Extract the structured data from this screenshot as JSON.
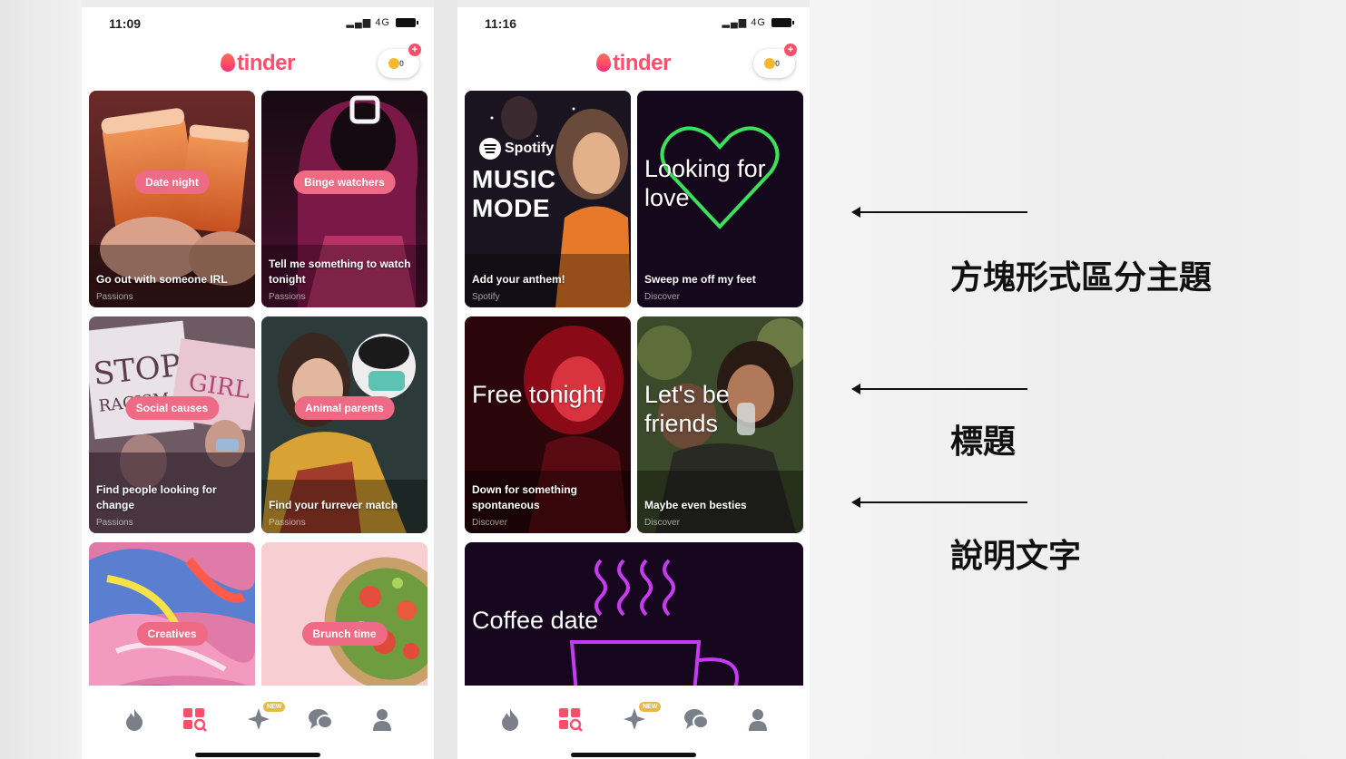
{
  "phones": [
    {
      "time": "11:09",
      "network": "4G",
      "logo": "tinder",
      "boost_count": "0",
      "cards": [
        {
          "pill": "Date night",
          "desc": "Go out with someone IRL",
          "cat": "Passions"
        },
        {
          "pill": "Binge watchers",
          "desc": "Tell me something to watch tonight",
          "cat": "Passions"
        },
        {
          "pill": "Social causes",
          "desc": "Find people looking for change",
          "cat": "Passions"
        },
        {
          "pill": "Animal parents",
          "desc": "Find your furrever match",
          "cat": "Passions"
        },
        {
          "pill": "Creatives"
        },
        {
          "pill": "Brunch time"
        }
      ],
      "nav": [
        "flame-icon",
        "explore-icon",
        "sparkle-icon",
        "chat-icon",
        "profile-icon"
      ],
      "new_badge": "NEW"
    },
    {
      "time": "11:16",
      "network": "4G",
      "logo": "tinder",
      "boost_count": "0",
      "cards": [
        {
          "brand": "Spotify",
          "big": "MUSIC MODE",
          "desc": "Add your anthem!",
          "cat": "Spotify"
        },
        {
          "big": "Looking for love",
          "desc": "Sweep me off my feet",
          "cat": "Discover"
        },
        {
          "big": "Free tonight",
          "desc": "Down for something spontaneous",
          "cat": "Discover"
        },
        {
          "big": "Let's be friends",
          "desc": "Maybe even besties",
          "cat": "Discover"
        },
        {
          "big": "Coffee date"
        }
      ],
      "nav": [
        "flame-icon",
        "explore-icon",
        "sparkle-icon",
        "chat-icon",
        "profile-icon"
      ],
      "new_badge": "NEW"
    }
  ],
  "annotations": [
    {
      "label": "方塊形式區分主題"
    },
    {
      "label": "標題"
    },
    {
      "label": "說明文字"
    }
  ],
  "colors": {
    "brand": "#fe4f6a",
    "pill": "#ef6a84",
    "neon_green": "#39e25a",
    "neon_purple": "#c63bf0"
  }
}
